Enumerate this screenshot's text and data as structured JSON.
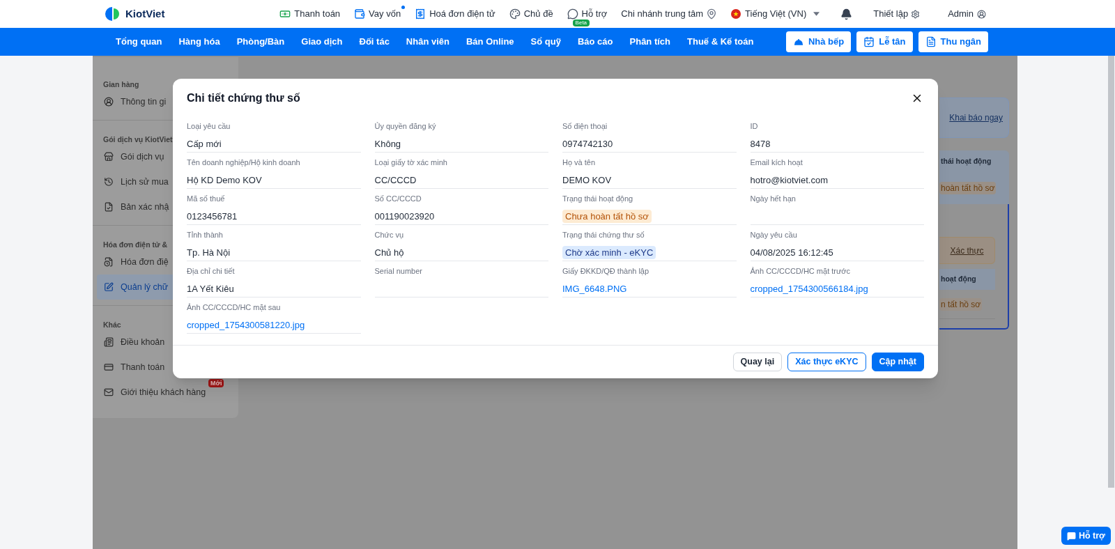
{
  "header": {
    "logo": "KiotViet",
    "links": [
      {
        "kind": "pay",
        "label": "Thanh toán"
      },
      {
        "kind": "loan",
        "label": "Vay vốn",
        "dot": true
      },
      {
        "kind": "invoice",
        "label": "Hoá đơn điện tử"
      },
      {
        "kind": "theme",
        "label": "Chủ đề"
      },
      {
        "kind": "help",
        "label": "Hỗ trợ",
        "badge": "Beta"
      }
    ],
    "branch": "Chi nhánh trung tâm",
    "language": "Tiếng Việt (VN)",
    "settings": "Thiết lập",
    "user": "Admin"
  },
  "nav": {
    "items": [
      "Tổng quan",
      "Hàng hóa",
      "Phòng/Bàn",
      "Giao dịch",
      "Đối tác",
      "Nhân viên",
      "Bán Online",
      "Sổ quỹ",
      "Báo cáo",
      "Phân tích",
      "Thuế & Kế toán"
    ],
    "buttons": [
      {
        "kind": "kitchen",
        "label": "Nhà bếp"
      },
      {
        "kind": "reception",
        "label": "Lễ tân"
      },
      {
        "kind": "cashier",
        "label": "Thu ngân"
      }
    ]
  },
  "sidebar": [
    {
      "title": "Gian hàng",
      "items": [
        {
          "kind": "user",
          "label": "Thông tin gi",
          "selected": false
        }
      ]
    },
    {
      "title": "Gói dịch vụ KiotViet",
      "items": [
        {
          "kind": "store",
          "label": "Gói dịch vụ",
          "selected": false
        },
        {
          "kind": "history",
          "label": "Lịch sử mua",
          "selected": false
        },
        {
          "kind": "doc",
          "label": "Bản xác nhậ",
          "selected": false
        }
      ]
    },
    {
      "title": "Hóa đơn điện tử &",
      "items": [
        {
          "kind": "invoice",
          "label": "Hóa đơn điệ",
          "selected": false
        },
        {
          "kind": "edit",
          "label": "Quản lý chữ",
          "selected": true
        }
      ]
    },
    {
      "title": "Khác",
      "items": [
        {
          "kind": "terms",
          "label": "Điều khoản",
          "selected": false
        },
        {
          "kind": "card",
          "label": "Thanh toán",
          "selected": false
        },
        {
          "kind": "mail",
          "label": "Giới thiệu khách hàng",
          "selected": false,
          "badge": "Mới"
        }
      ]
    }
  ],
  "background": {
    "declare_link": "Khai báo ngay",
    "table_header": "thái hoạt động",
    "status": "hoàn tất hồ sơ",
    "verify_link": "Xác thực",
    "table_header_2": "hoạt động",
    "status_2": "n tất hồ sơ"
  },
  "modal": {
    "title": "Chi tiết chứng thư số",
    "fields": [
      {
        "label": "Loại yêu cầu",
        "kind": "text",
        "value": "Cấp mới"
      },
      {
        "label": "Ủy quyền đăng ký",
        "kind": "text",
        "value": "Không"
      },
      {
        "label": "Số điện thoại",
        "kind": "text",
        "value": "0974742130"
      },
      {
        "label": "ID",
        "kind": "text",
        "value": "8478"
      },
      {
        "label": "Tên doanh nghiệp/Hộ kinh doanh",
        "kind": "text",
        "value": "Hộ KD Demo KOV"
      },
      {
        "label": "Loại giấy tờ xác minh",
        "kind": "text",
        "value": "CC/CCCD"
      },
      {
        "label": "Họ và tên",
        "kind": "text",
        "value": "DEMO KOV"
      },
      {
        "label": "Email kích hoạt",
        "kind": "text",
        "value": "hotro@kiotviet.com"
      },
      {
        "label": "Mã số thuế",
        "kind": "text",
        "value": "0123456781"
      },
      {
        "label": "Số CC/CCCD",
        "kind": "text",
        "value": "001190023920"
      },
      {
        "label": "Trạng thái hoạt động",
        "kind": "warning",
        "value": "Chưa hoàn tất hồ sơ"
      },
      {
        "label": "Ngày hết hạn",
        "kind": "empty"
      },
      {
        "label": "Tỉnh thành",
        "kind": "text",
        "value": "Tp. Hà Nội"
      },
      {
        "label": "Chức vụ",
        "kind": "text",
        "value": "Chủ hộ"
      },
      {
        "label": "Trạng thái chứng thư số",
        "kind": "info",
        "value": "Chờ xác minh - eKYC"
      },
      {
        "label": "Ngày yêu cầu",
        "kind": "text",
        "value": "04/08/2025 16:12:45"
      },
      {
        "label": "Địa chỉ chi tiết",
        "kind": "text",
        "value": "1A Yết Kiêu"
      },
      {
        "label": "Serial number",
        "kind": "empty"
      },
      {
        "label": "Giấy ĐKKD/QĐ thành lập",
        "kind": "link",
        "value": "IMG_6648.PNG"
      },
      {
        "label": "Ảnh CC/CCCD/HC mặt trước",
        "kind": "link",
        "value": "cropped_1754300566184.jpg"
      },
      {
        "label": "Ảnh CC/CCCD/HC mặt sau",
        "kind": "link",
        "value": "cropped_1754300581220.jpg"
      }
    ],
    "buttons": [
      {
        "kind": "secondary",
        "label": "Quay lại"
      },
      {
        "kind": "outline",
        "label": "Xác thực eKYC"
      },
      {
        "kind": "primary",
        "label": "Cập nhật"
      }
    ]
  },
  "support_button": "Hỗ trợ"
}
